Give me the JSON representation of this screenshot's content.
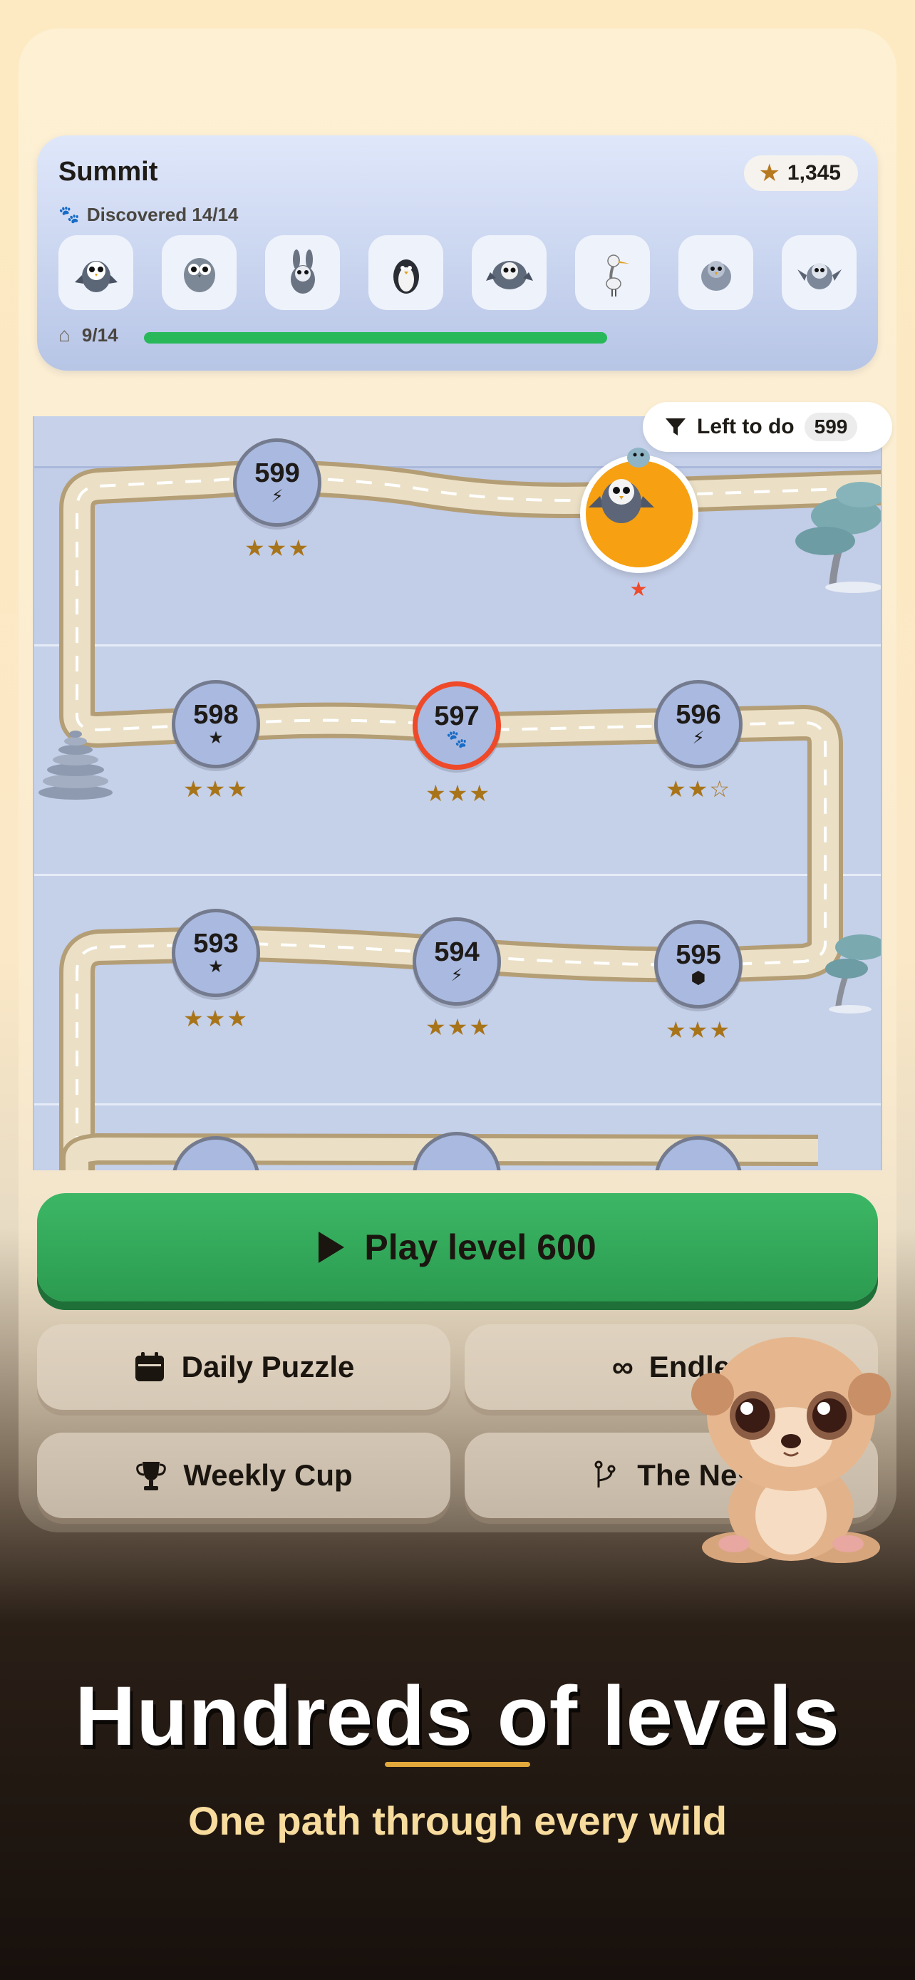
{
  "header": {
    "title": "Summit",
    "stars_total": "1,345",
    "discovered_label": "Discovered 14/14",
    "creature_icons": [
      "owl-icon",
      "owl-icon",
      "rabbit-icon",
      "penguin-icon",
      "owl-icon",
      "heron-icon",
      "owl-icon",
      "bird-icon"
    ],
    "progress_label": "9/14",
    "progress_fraction": 0.643
  },
  "filter": {
    "label": "Left to do",
    "count": "599"
  },
  "map": {
    "nodes": [
      {
        "number": "599",
        "symbol": "⚡",
        "stars": "★★★",
        "current": false
      },
      {
        "number": "598",
        "symbol": "★",
        "stars": "★★★",
        "current": false
      },
      {
        "number": "597",
        "symbol": "🐾",
        "stars": "★★★",
        "current": true
      },
      {
        "number": "596",
        "symbol": "⚡",
        "stars": "★★☆",
        "current": false
      },
      {
        "number": "593",
        "symbol": "★",
        "stars": "★★★",
        "current": false
      },
      {
        "number": "594",
        "symbol": "⚡",
        "stars": "★★★",
        "current": false
      },
      {
        "number": "595",
        "symbol": "⬢",
        "stars": "★★★",
        "current": false
      }
    ],
    "next_node_stars": "★"
  },
  "buttons": {
    "play": "Play level 600",
    "daily": "Daily Puzzle",
    "endless": "Endle",
    "weekly": "Weekly Cup",
    "nest": "The Nes"
  },
  "promo": {
    "headline": "Hundreds of levels",
    "subline": "One path through every wild"
  },
  "colors": {
    "play_green": "#2b9b50",
    "accent_orange": "#f6a012",
    "current_red": "#ee4a2a",
    "star_gold": "#a8741a"
  }
}
